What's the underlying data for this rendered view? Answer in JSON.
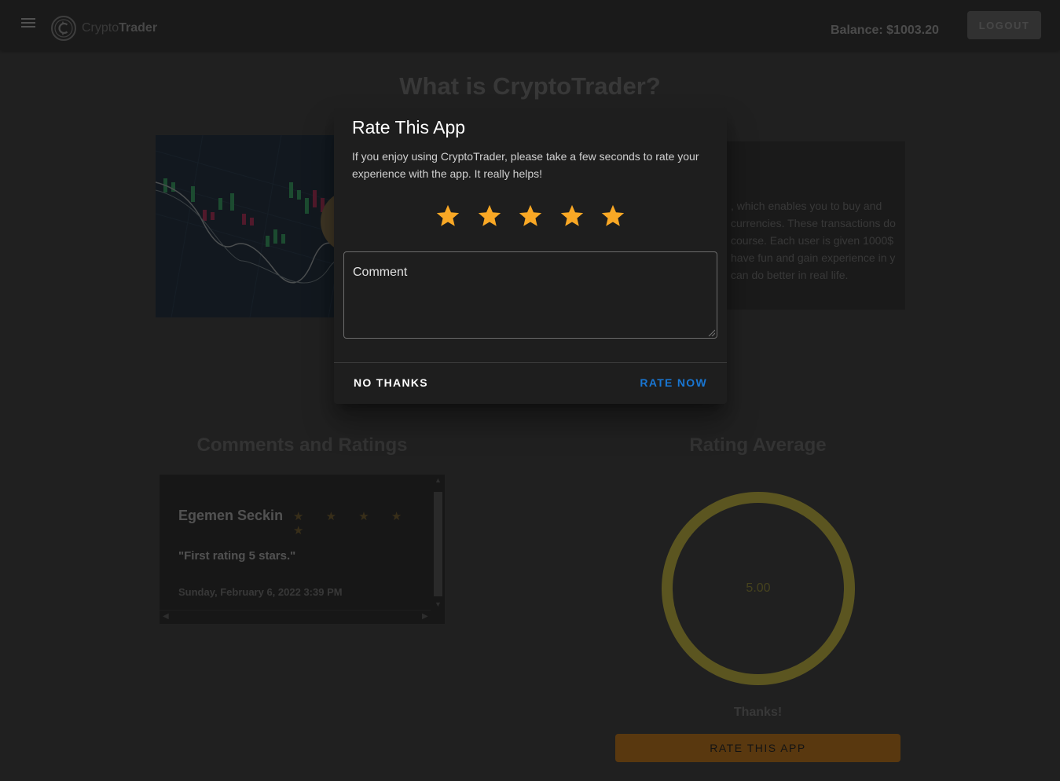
{
  "header": {
    "brand_part1": "Crypto",
    "brand_part2": "Trader",
    "balance": "Balance: $1003.20",
    "logout_label": "LOGOUT"
  },
  "about": {
    "title": "What is CryptoTrader?",
    "text_visible": ", which enables you to buy and currencies. These transactions do course. Each user is given 1000$ have fun and gain experience in y can do better in real life."
  },
  "comments": {
    "section_title": "Comments and Ratings",
    "items": [
      {
        "name": "Egemen Seckin",
        "stars": "★ ★ ★ ★ ★",
        "text": "\"First rating 5 stars.\"",
        "date": "Sunday, February 6, 2022 3:39 PM"
      }
    ]
  },
  "rating": {
    "section_title": "Rating Average",
    "value": "5.00",
    "thanks": "Thanks!",
    "rate_button_label": "RATE THIS APP",
    "ring_color": "#FFEB3B"
  },
  "dialog": {
    "title": "Rate This App",
    "text": "If you enjoy using CryptoTrader, please take a few seconds to rate your experience with the app. It really helps!",
    "stars_selected": 5,
    "star_color": "#F9A825",
    "comment_label": "Comment",
    "no_thanks_label": "NO THANKS",
    "rate_now_label": "RATE NOW"
  },
  "colors": {
    "background": "#212121",
    "appbar": "#272727",
    "accent_blue": "#1976D2",
    "accent_orange": "#FB8C00"
  }
}
